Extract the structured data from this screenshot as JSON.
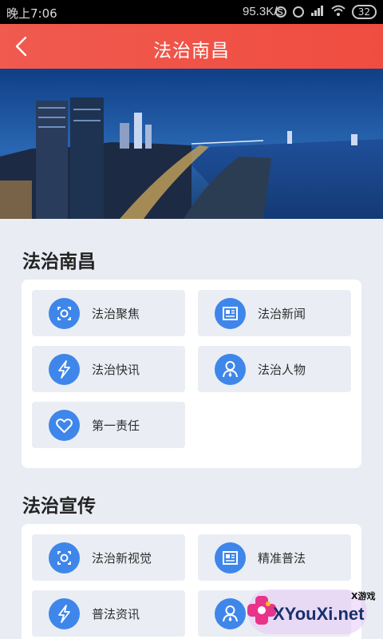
{
  "status_bar": {
    "time": "晚上7:06",
    "network_speed": "95.3K/s",
    "battery": "32",
    "icons": [
      "bluetooth-icon",
      "alarm-icon",
      "signal-icon",
      "wifi-icon"
    ]
  },
  "header": {
    "title": "法治南昌",
    "back_icon": "chevron-left-icon",
    "color": "#ef5146"
  },
  "banner": {
    "description_icon": "city-skyline-image"
  },
  "sections": [
    {
      "heading": "法治南昌",
      "tiles": [
        {
          "label": "法治聚焦",
          "icon": "focus-icon"
        },
        {
          "label": "法治新闻",
          "icon": "news-icon"
        },
        {
          "label": "法治快讯",
          "icon": "lightning-icon"
        },
        {
          "label": "法治人物",
          "icon": "person-icon"
        },
        {
          "label": "第一责任",
          "icon": "heart-icon"
        }
      ]
    },
    {
      "heading": "法治宣传",
      "tiles": [
        {
          "label": "法治新视觉",
          "icon": "focus-icon"
        },
        {
          "label": "精准普法",
          "icon": "news-icon"
        },
        {
          "label": "普法资讯",
          "icon": "lightning-icon"
        },
        {
          "label": "",
          "icon": "person-icon"
        }
      ]
    }
  ],
  "watermark": {
    "small_text": "X游戏",
    "brand_text": "XYouXi.net"
  },
  "colors": {
    "accent_blue": "#3f86ea",
    "tile_bg": "#eaeef4",
    "page_bg": "#e9edf3"
  }
}
